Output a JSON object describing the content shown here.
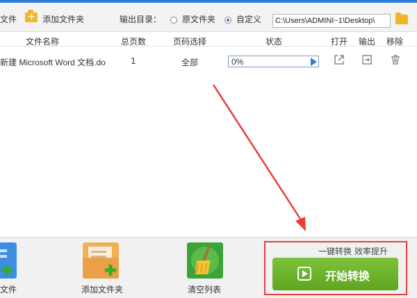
{
  "toolbar": {
    "add_file_label": "文件",
    "add_folder_label": "添加文件夹",
    "output_dir_label": "输出目录：",
    "option_source": "原文件夹",
    "option_custom": "自定义",
    "output_path": "C:\\Users\\ADMINI~1\\Desktop\\"
  },
  "table": {
    "headers": [
      "文件名称",
      "总页数",
      "页码选择",
      "状态",
      "打开",
      "输出",
      "移除"
    ],
    "rows": [
      {
        "filename": "新建 Microsoft Word 文档.do",
        "pages": "1",
        "page_selection": "全部",
        "progress_text": "0%",
        "progress": 0
      }
    ]
  },
  "bottom": {
    "add_file_label": "文件",
    "add_folder_label": "添加文件夹",
    "clear_list_label": "清空列表",
    "slogan": "一键转换  效率提升",
    "start_label": "开始转换"
  },
  "colors": {
    "accent_green": "#6cb52c",
    "highlight_red": "#e83d3d",
    "folder_yellow": "#f0b52b"
  }
}
